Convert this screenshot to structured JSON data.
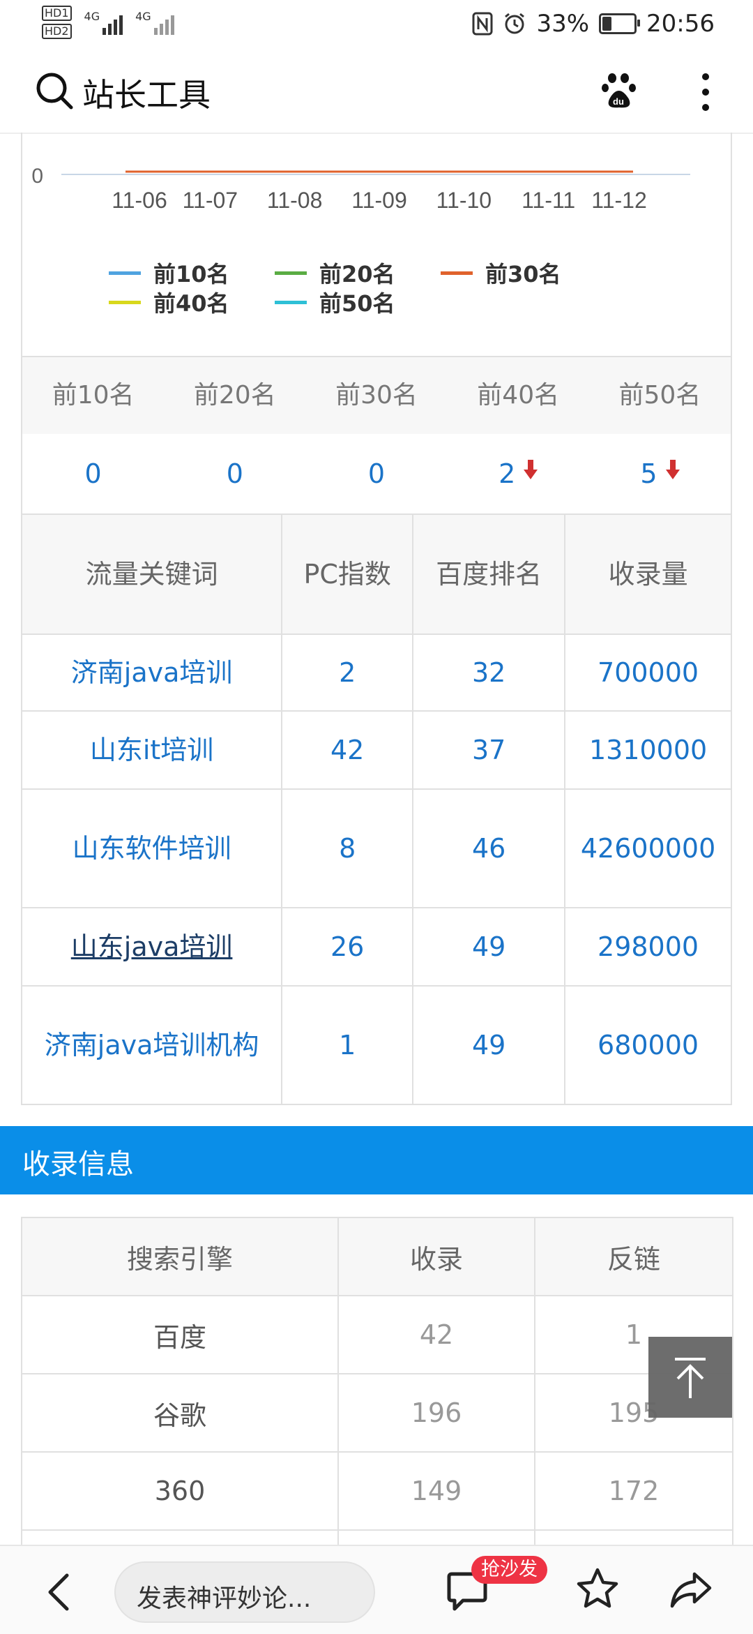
{
  "status_bar": {
    "hd1": "HD1",
    "hd2": "HD2",
    "net1": "4G",
    "net2": "4G",
    "battery": "33%",
    "battery_level": 0.33,
    "time": "20:56",
    "icons": [
      "nfc-icon",
      "alarm-icon",
      "battery-icon"
    ]
  },
  "header": {
    "title": "站长工具",
    "icons": [
      "search-icon",
      "baidu-paw-icon",
      "more-vertical-icon"
    ]
  },
  "chart_data": {
    "type": "line",
    "x": [
      "11-06",
      "11-07",
      "11-08",
      "11-09",
      "11-10",
      "11-11",
      "11-12"
    ],
    "y_tick_visible": "0",
    "series": [
      {
        "name": "前10名",
        "color": "#4fa3e0",
        "values": [
          0,
          0,
          0,
          0,
          0,
          0,
          0
        ]
      },
      {
        "name": "前20名",
        "color": "#5aac43",
        "values": [
          0,
          0,
          0,
          0,
          0,
          0,
          0
        ]
      },
      {
        "name": "前30名",
        "color": "#e0622c",
        "values": [
          0,
          0,
          0,
          0,
          0,
          0,
          0
        ]
      },
      {
        "name": "前40名",
        "color": "#d8d81c",
        "values": [
          0,
          0,
          0,
          0,
          0,
          0,
          0
        ]
      },
      {
        "name": "前50名",
        "color": "#2ec0d6",
        "values": [
          0,
          0,
          0,
          0,
          0,
          0,
          0
        ]
      }
    ],
    "legend": "bottom"
  },
  "rank_summary": {
    "headers": [
      "前10名",
      "前20名",
      "前30名",
      "前40名",
      "前50名"
    ],
    "values": [
      "0",
      "0",
      "0",
      "2",
      "5"
    ],
    "trend": [
      "",
      "",
      "",
      "down",
      "down"
    ]
  },
  "keywords_table": {
    "headers": [
      "流量关键词",
      "PC指数",
      "百度排名",
      "收录量"
    ],
    "rows": [
      [
        "济南java培训",
        "2",
        "32",
        "700000"
      ],
      [
        "山东it培训",
        "42",
        "37",
        "1310000"
      ],
      [
        "山东软件培训",
        "8",
        "46",
        "42600000"
      ],
      [
        "山东java培训",
        "26",
        "49",
        "298000"
      ],
      [
        "济南java培训机构",
        "1",
        "49",
        "680000"
      ]
    ]
  },
  "index_section": {
    "title": "收录信息"
  },
  "index_table": {
    "headers": [
      "搜索引擎",
      "收录",
      "反链"
    ],
    "rows": [
      [
        "百度",
        "42",
        "1"
      ],
      [
        "谷歌",
        "196",
        "195"
      ],
      [
        "360",
        "149",
        "172"
      ]
    ]
  },
  "colors": {
    "accent": "#0a8ee8",
    "link": "#1a73c8",
    "down_arrow": "#d03030",
    "badge": "#ee3344"
  },
  "bottom_bar": {
    "comment_placeholder": "发表神评妙论...",
    "sofa_badge": "抢沙发",
    "icons": [
      "back-arrow-icon",
      "chat-bubble-icon",
      "star-icon",
      "share-icon"
    ]
  }
}
